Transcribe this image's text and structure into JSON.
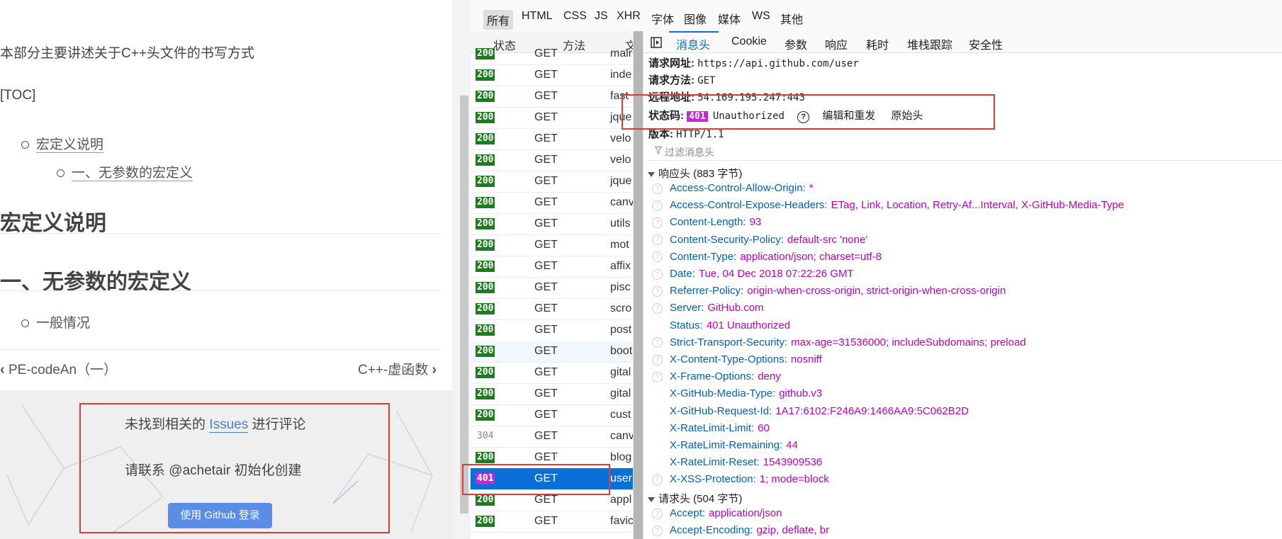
{
  "blog": {
    "intro": "本部分主要讲述关于C++头文件的书写方式",
    "toc_marker": "[TOC]",
    "toc": [
      "宏定义说明",
      "一、无参数的宏定义"
    ],
    "heading1": "宏定义说明",
    "heading2": "一、无参数的宏定义",
    "bullet": "一般情况",
    "prev_post": "PE-codeAn（一）",
    "next_post": "C++-虚函数",
    "comment_prefix": "未找到相关的",
    "comment_link": "Issues",
    "comment_suffix": "进行评论",
    "comment_contact": "请联系 @achetair 初始化创建",
    "login_button": "使用 Github 登录"
  },
  "devtools": {
    "filters": [
      "所有",
      "HTML",
      "CSS",
      "JS",
      "XHR",
      "字体",
      "图像",
      "媒体",
      "WS",
      "其他"
    ],
    "columns": {
      "status": "状态",
      "method": "方法",
      "file": "文"
    },
    "requests": [
      {
        "status": "200",
        "method": "GET",
        "file": "mair"
      },
      {
        "status": "200",
        "method": "GET",
        "file": "inde"
      },
      {
        "status": "200",
        "method": "GET",
        "file": "fast"
      },
      {
        "status": "200",
        "method": "GET",
        "file": "jque"
      },
      {
        "status": "200",
        "method": "GET",
        "file": "velo"
      },
      {
        "status": "200",
        "method": "GET",
        "file": "velo"
      },
      {
        "status": "200",
        "method": "GET",
        "file": "jque"
      },
      {
        "status": "200",
        "method": "GET",
        "file": "canv"
      },
      {
        "status": "200",
        "method": "GET",
        "file": "utils"
      },
      {
        "status": "200",
        "method": "GET",
        "file": "mot"
      },
      {
        "status": "200",
        "method": "GET",
        "file": "affix"
      },
      {
        "status": "200",
        "method": "GET",
        "file": "pisc"
      },
      {
        "status": "200",
        "method": "GET",
        "file": "scro"
      },
      {
        "status": "200",
        "method": "GET",
        "file": "post"
      },
      {
        "status": "200",
        "method": "GET",
        "file": "boot"
      },
      {
        "status": "200",
        "method": "GET",
        "file": "gital"
      },
      {
        "status": "200",
        "method": "GET",
        "file": "gital"
      },
      {
        "status": "200",
        "method": "GET",
        "file": "cust"
      },
      {
        "status": "304",
        "method": "GET",
        "file": "canv"
      },
      {
        "status": "200",
        "method": "GET",
        "file": "blog"
      },
      {
        "status": "401",
        "method": "GET",
        "file": "user"
      },
      {
        "status": "200",
        "method": "GET",
        "file": "appl"
      },
      {
        "status": "200",
        "method": "GET",
        "file": "favic"
      }
    ],
    "tabs": [
      "消息头",
      "Cookie",
      "参数",
      "响应",
      "耗时",
      "堆栈跟踪",
      "安全性"
    ],
    "summary": {
      "url_label": "请求网址:",
      "url": "https://api.github.com/user",
      "method_label": "请求方法:",
      "method": "GET",
      "remote_label": "远程地址:",
      "remote": "54.169.195.247:443",
      "status_label": "状态码:",
      "status_code": "401",
      "status_text": "Unauthorized",
      "help_glyph": "?",
      "edit_resend": "编辑和重发",
      "raw_headers": "原始头",
      "version_label": "版本:",
      "version": "HTTP/1.1"
    },
    "filter_placeholder": "过滤消息头",
    "response_section": "响应头 (883 字节)",
    "response_headers": [
      {
        "name": "Access-Control-Allow-Origin:",
        "value": "*",
        "q": true
      },
      {
        "name": "Access-Control-Expose-Headers:",
        "value": "ETag, Link, Location, Retry-Af...Interval, X-GitHub-Media-Type",
        "q": true
      },
      {
        "name": "Content-Length:",
        "value": "93",
        "q": true
      },
      {
        "name": "Content-Security-Policy:",
        "value": "default-src 'none'",
        "q": true
      },
      {
        "name": "Content-Type:",
        "value": "application/json; charset=utf-8",
        "q": true
      },
      {
        "name": "Date:",
        "value": "Tue, 04 Dec 2018 07:22:26 GMT",
        "q": true
      },
      {
        "name": "Referrer-Policy:",
        "value": "origin-when-cross-origin, strict-origin-when-cross-origin",
        "q": true
      },
      {
        "name": "Server:",
        "value": "GitHub.com",
        "q": true
      },
      {
        "name": "Status:",
        "value": "401 Unauthorized",
        "q": false
      },
      {
        "name": "Strict-Transport-Security:",
        "value": "max-age=31536000; includeSubdomains; preload",
        "q": true
      },
      {
        "name": "X-Content-Type-Options:",
        "value": "nosniff",
        "q": true
      },
      {
        "name": "X-Frame-Options:",
        "value": "deny",
        "q": true
      },
      {
        "name": "X-GitHub-Media-Type:",
        "value": "github.v3",
        "q": false
      },
      {
        "name": "X-GitHub-Request-Id:",
        "value": "1A17:6102:F246A9:1466AA9:5C062B2D",
        "q": false
      },
      {
        "name": "X-RateLimit-Limit:",
        "value": "60",
        "q": false
      },
      {
        "name": "X-RateLimit-Remaining:",
        "value": "44",
        "q": false
      },
      {
        "name": "X-RateLimit-Reset:",
        "value": "1543909536",
        "q": false
      },
      {
        "name": "X-XSS-Protection:",
        "value": "1; mode=block",
        "q": true
      }
    ],
    "request_section": "请求头 (504 字节)",
    "request_headers": [
      {
        "name": "Accept:",
        "value": "application/json",
        "q": true
      },
      {
        "name": "Accept-Encoding:",
        "value": "gzip, deflate, br",
        "q": true
      }
    ]
  },
  "colors": {
    "ok": "#1a7f1a",
    "unauthorized": "#c22bd6",
    "selected": "#0a6fd6",
    "highlight": "#e03a3a"
  }
}
